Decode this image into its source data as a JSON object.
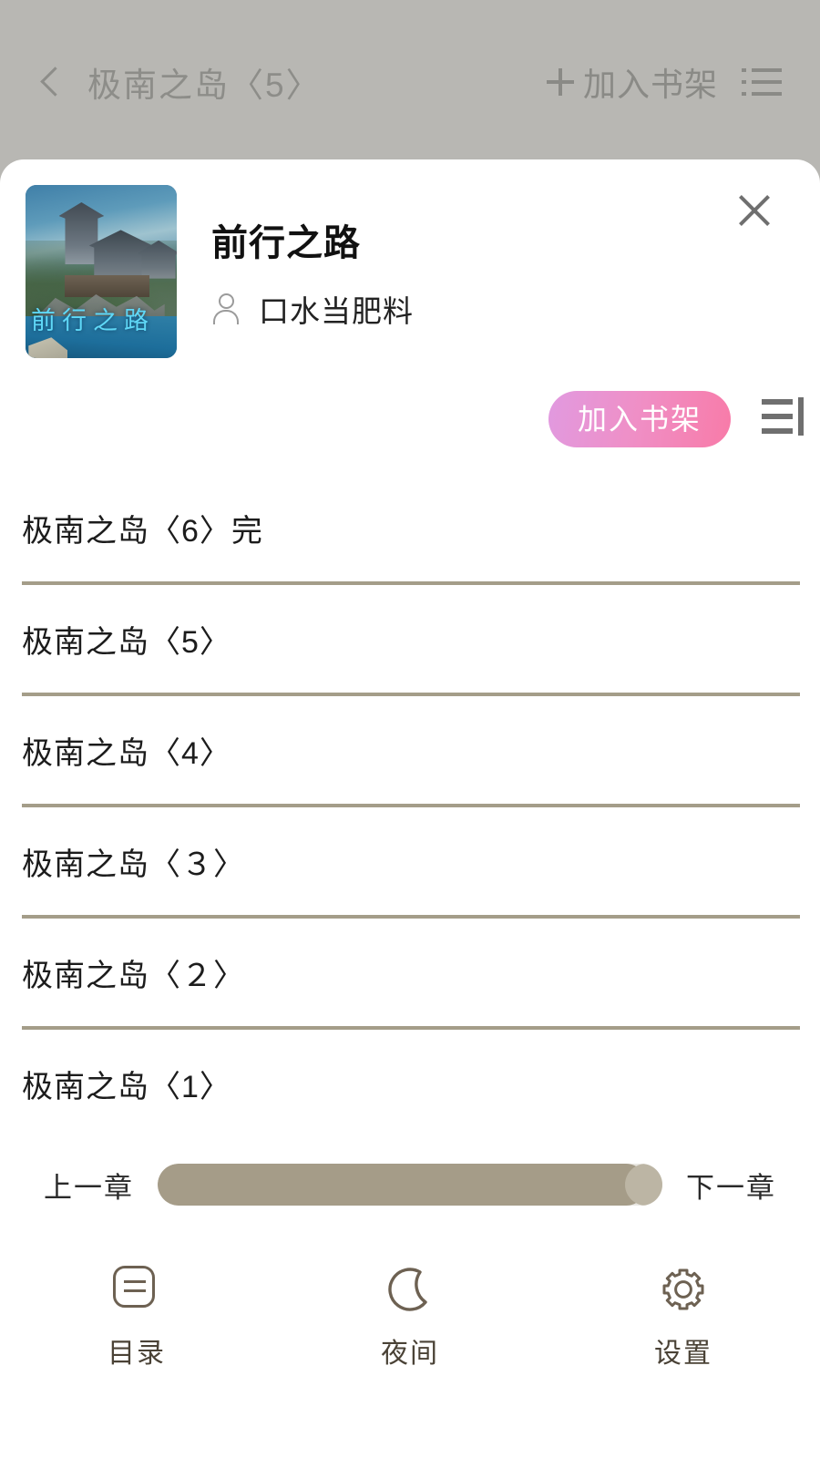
{
  "reader_header": {
    "back_icon": "chevron-left-icon",
    "chapter_title": "极南之岛〈5〉",
    "add_icon": "plus-icon",
    "add_label": "加入书架",
    "menu_icon": "list-menu-icon"
  },
  "sheet": {
    "close_icon": "close-icon",
    "book": {
      "title": "前行之路",
      "author": "口水当肥料",
      "author_icon": "person-icon",
      "cover_title": "前行之路",
      "cover_title_color": "#5fd8f7"
    },
    "actions": {
      "add_shelf_label": "加入书架",
      "add_shelf_color_start": "#e19ae0",
      "add_shelf_color_end": "#f87ba8",
      "sort_icon": "sort-order-icon"
    },
    "chapters": [
      {
        "title": "极南之岛〈6〉完"
      },
      {
        "title": "极南之岛〈5〉"
      },
      {
        "title": "极南之岛〈4〉"
      },
      {
        "title": "极南之岛〈３〉"
      },
      {
        "title": "极南之岛〈２〉"
      },
      {
        "title": "极南之岛〈1〉"
      }
    ],
    "chapter_nav": {
      "prev_label": "上一章",
      "next_label": "下一章",
      "progress_percent": 97,
      "track_color": "#a59c88"
    },
    "toolbar": [
      {
        "label": "目录",
        "icon": "catalog-icon"
      },
      {
        "label": "夜间",
        "icon": "moon-icon"
      },
      {
        "label": "设置",
        "icon": "gear-icon"
      }
    ]
  },
  "colors": {
    "header_bg": "#b8b7b3",
    "sheet_bg": "#ffffff",
    "divider": "#a49d89",
    "toolbar_text": "#4a4236"
  }
}
